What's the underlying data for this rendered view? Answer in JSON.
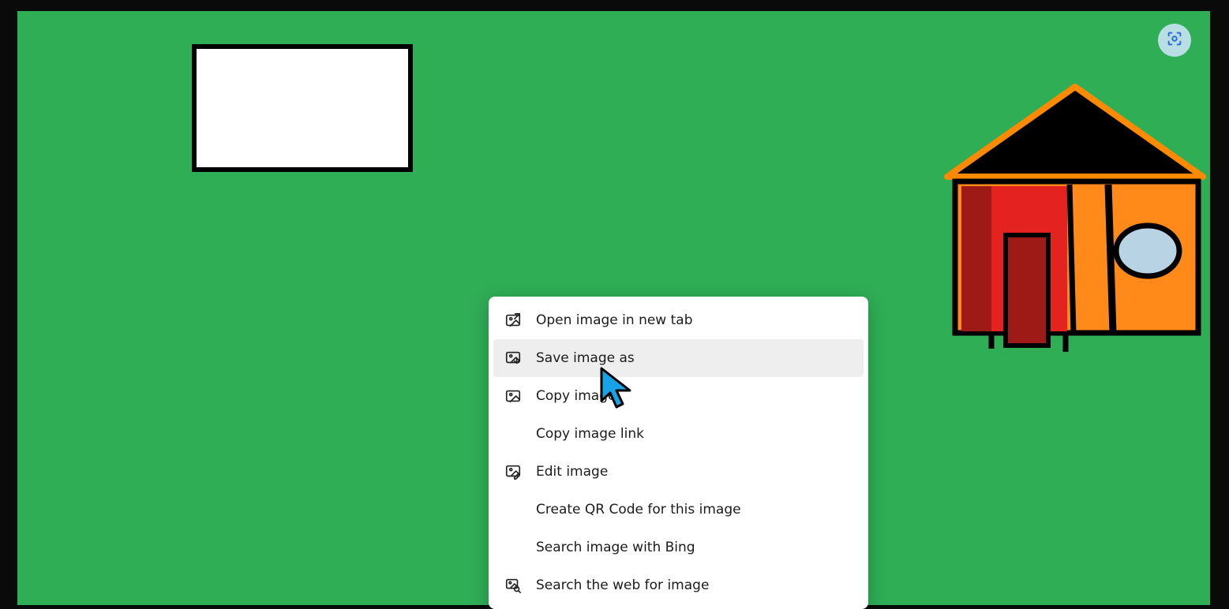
{
  "overlay_button": {
    "name": "visual-search"
  },
  "context_menu": {
    "highlighted_index": 1,
    "items": [
      {
        "label": "Open image in new tab",
        "icon": "open-image-icon"
      },
      {
        "label": "Save image as",
        "icon": "save-image-icon"
      },
      {
        "label": "Copy image",
        "icon": "copy-image-icon"
      },
      {
        "label": "Copy image link",
        "icon": null
      },
      {
        "label": "Edit image",
        "icon": "edit-image-icon"
      },
      {
        "label": "Create QR Code for this image",
        "icon": null
      },
      {
        "label": "Search image with Bing",
        "icon": null
      },
      {
        "label": "Search the web for image",
        "icon": "web-search-icon"
      }
    ]
  }
}
